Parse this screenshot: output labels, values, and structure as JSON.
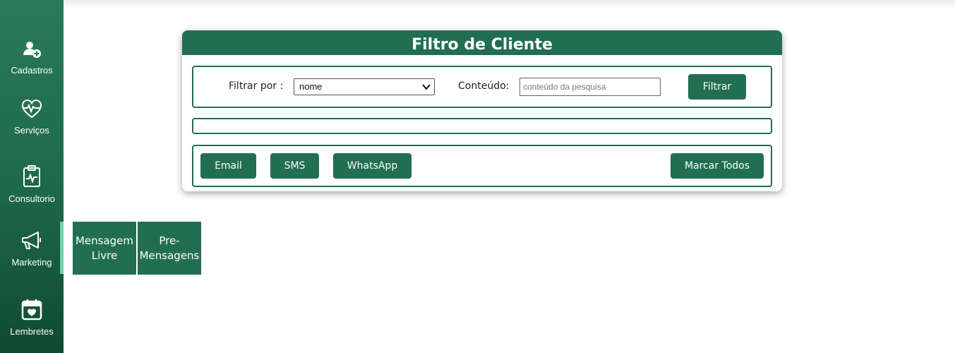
{
  "sidebar": {
    "items": [
      {
        "label": "Cadastros",
        "icon": "user-add-icon"
      },
      {
        "label": "Serviços",
        "icon": "heart-pulse-icon"
      },
      {
        "label": "Consultorio",
        "icon": "clipboard-pulse-icon"
      },
      {
        "label": "Marketing",
        "icon": "megaphone-icon"
      },
      {
        "label": "Lembretes",
        "icon": "calendar-heart-icon"
      }
    ],
    "active": "Marketing"
  },
  "card": {
    "title": "Filtro de Cliente",
    "filter_label": "Filtrar por :",
    "filter_value": "nome",
    "content_label": "Conteúdo:",
    "content_placeholder": "conteúdo da pesquisa",
    "filter_button": "Filtrar"
  },
  "actions": {
    "email": "Email",
    "sms": "SMS",
    "whatsapp": "WhatsApp",
    "select_all": "Marcar Todos"
  },
  "tabs": [
    {
      "label_line1": "Mensagem",
      "label_line2": "Livre"
    },
    {
      "label_line1": "Pre-",
      "label_line2": "Mensagens"
    }
  ],
  "colors": {
    "primary": "#226e52",
    "active_indicator": "#6fd4a6"
  }
}
